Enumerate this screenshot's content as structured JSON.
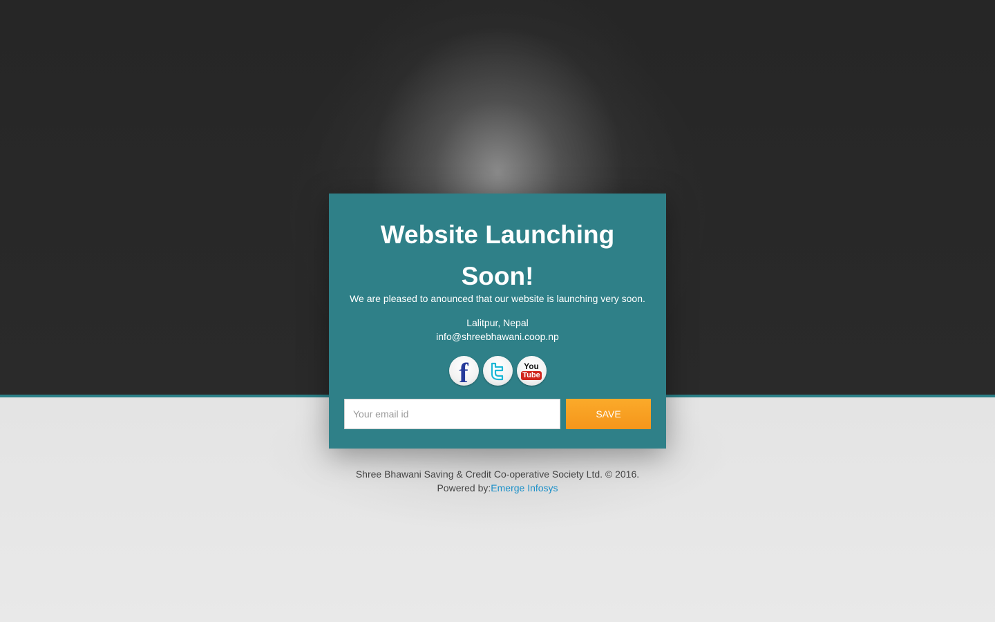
{
  "headline": "Website Launching Soon!",
  "intro_text": "We are pleased to anounced that our website is launching very soon.",
  "contact": {
    "location": "Lalitpur, Nepal",
    "email": "info@shreebhawani.coop.np"
  },
  "social": {
    "facebook_glyph": "f",
    "youtube_top": "You",
    "youtube_bottom": "Tube",
    "icons": [
      "facebook-icon",
      "twitter-icon",
      "youtube-icon"
    ]
  },
  "signup": {
    "placeholder": "Your email id",
    "button_label": "SAVE"
  },
  "footer": {
    "copyright": "Shree Bhawani Saving & Credit Co-operative Society Ltd. © 2016.",
    "powered_by_label": "Powered by:",
    "powered_by_link": "Emerge Infosys"
  },
  "colors": {
    "card_background": "#2f8088",
    "divider": "#2b8088",
    "button": "#f5961b",
    "link": "#1a8fc8",
    "top_background": "#262626",
    "bottom_background": "#e6e6e6"
  }
}
